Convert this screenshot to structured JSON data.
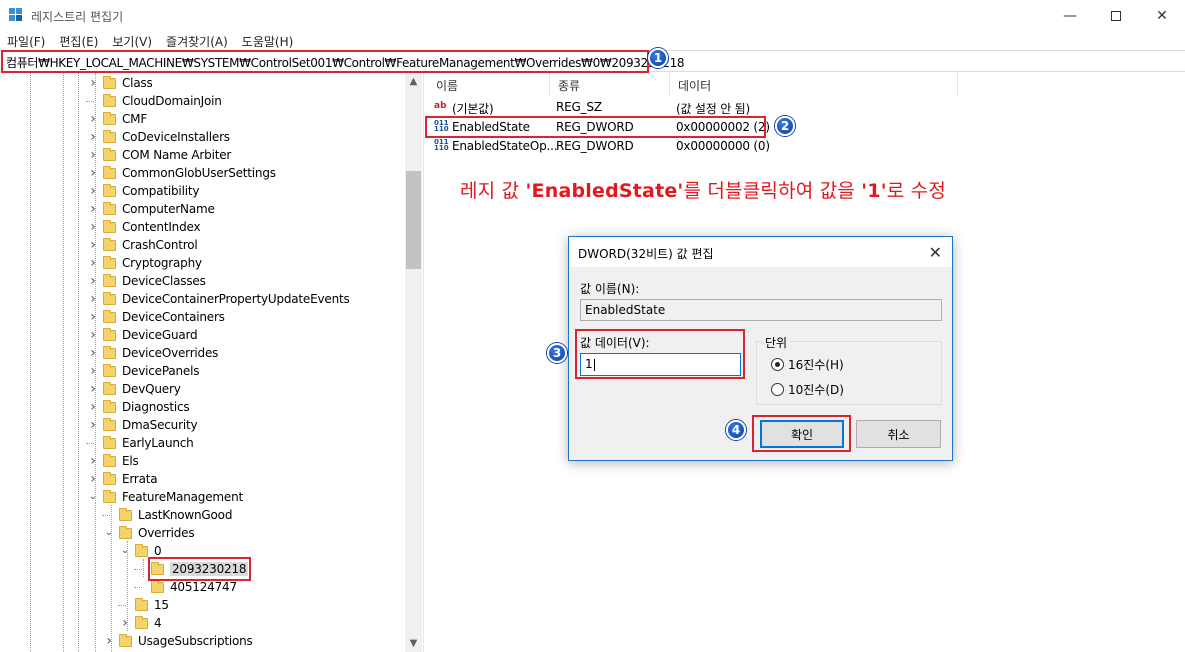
{
  "window": {
    "title": "레지스트리 편집기"
  },
  "menu": [
    "파일(F)",
    "편집(E)",
    "보기(V)",
    "즐겨찾기(A)",
    "도움말(H)"
  ],
  "address": {
    "path": "컴퓨터₩HKEY_LOCAL_MACHINE₩SYSTEM₩ControlSet001₩Control₩FeatureManagement₩Overrides₩0₩2093230218"
  },
  "badges": [
    "1",
    "2",
    "3",
    "4"
  ],
  "tree": [
    "Class",
    "CloudDomainJoin",
    "CMF",
    "CoDeviceInstallers",
    "COM Name Arbiter",
    "CommonGlobUserSettings",
    "Compatibility",
    "ComputerName",
    "ContentIndex",
    "CrashControl",
    "Cryptography",
    "DeviceClasses",
    "DeviceContainerPropertyUpdateEvents",
    "DeviceContainers",
    "DeviceGuard",
    "DeviceOverrides",
    "DevicePanels",
    "DevQuery",
    "Diagnostics",
    "DmaSecurity",
    "EarlyLaunch",
    "Els",
    "Errata",
    "FeatureManagement",
    "LastKnownGood",
    "Overrides",
    "0",
    "2093230218",
    "405124747",
    "15",
    "4",
    "UsageSubscriptions"
  ],
  "columns": [
    "이름",
    "종류",
    "데이터"
  ],
  "values": [
    {
      "icon": "string-value-icon",
      "name": "(기본값)",
      "type": "REG_SZ",
      "data": "(값 설정 안 됨)"
    },
    {
      "icon": "dword-value-icon",
      "name": "EnabledState",
      "type": "REG_DWORD",
      "data": "0x00000002 (2)"
    },
    {
      "icon": "dword-value-icon",
      "name": "EnabledStateOp...",
      "type": "REG_DWORD",
      "data": "0x00000000 (0)"
    }
  ],
  "instruction": {
    "part1": "레지 값 ",
    "key": "'EnabledState'",
    "part2": "를 더블클릭하여 값을 ",
    "value": "'1'",
    "part3": "로 수정"
  },
  "dialog": {
    "title": "DWORD(32비트) 값 편집",
    "name_label": "값 이름(N):",
    "name_value": "EnabledState",
    "data_label": "값 데이터(V):",
    "data_value": "1",
    "base_label": "단위",
    "hex_label": "16진수(H)",
    "dec_label": "10진수(D)",
    "ok_label": "확인",
    "cancel_label": "취소"
  },
  "colors": {
    "highlight_red": "#d8262e",
    "badge_blue": "#0b3ea8",
    "folder_yellow": "#f5d36b",
    "dialog_border": "#1e74c8"
  }
}
